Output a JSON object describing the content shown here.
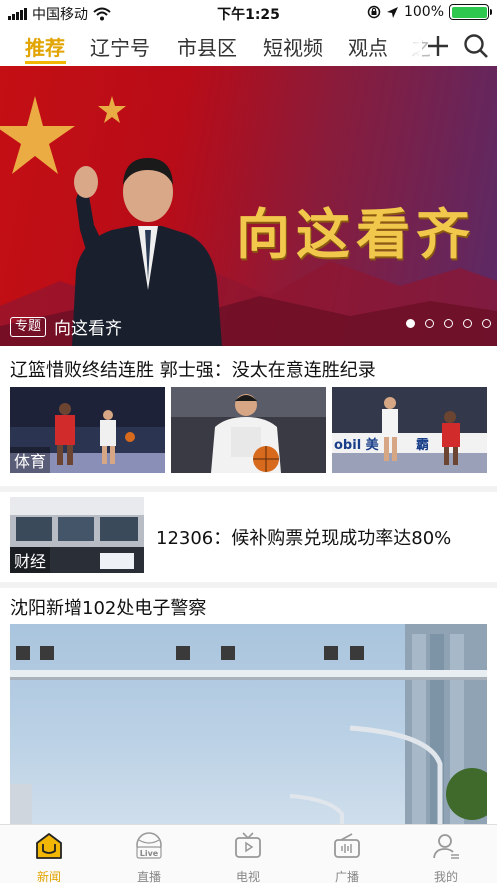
{
  "status_bar": {
    "carrier": "中国移动",
    "time": "下午1:25",
    "battery_percent": "100%",
    "battery_level": 1.0
  },
  "tabs": {
    "items": [
      "推荐",
      "辽宁号",
      "市县区",
      "短视频",
      "观点",
      "之"
    ],
    "active_index": 0,
    "accent_color": "#e2a400"
  },
  "toolbar": {
    "add_icon": "plus-icon",
    "search_icon": "search-icon"
  },
  "hero": {
    "title": "向这看齐",
    "tag": "专题",
    "caption": "向这看齐",
    "page_count": 5,
    "active_page": 0
  },
  "news": [
    {
      "title": "辽篮惜败终结连胜 郭士强：没太在意连胜纪录",
      "category": "体育",
      "sponsor_text": "obil 美",
      "sponsor_text_2": "霸"
    },
    {
      "title": "12306：候补购票兑现成功率达80%",
      "category": "财经"
    },
    {
      "title": "沈阳新增102处电子警察"
    }
  ],
  "bottom_nav": {
    "items": [
      {
        "label": "新闻",
        "icon": "news-icon"
      },
      {
        "label": "直播",
        "icon": "live-icon",
        "badge": "Live"
      },
      {
        "label": "电视",
        "icon": "tv-icon"
      },
      {
        "label": "广播",
        "icon": "radio-icon"
      },
      {
        "label": "我的",
        "icon": "profile-icon"
      }
    ],
    "active_index": 0,
    "active_color": "#e2a400"
  }
}
